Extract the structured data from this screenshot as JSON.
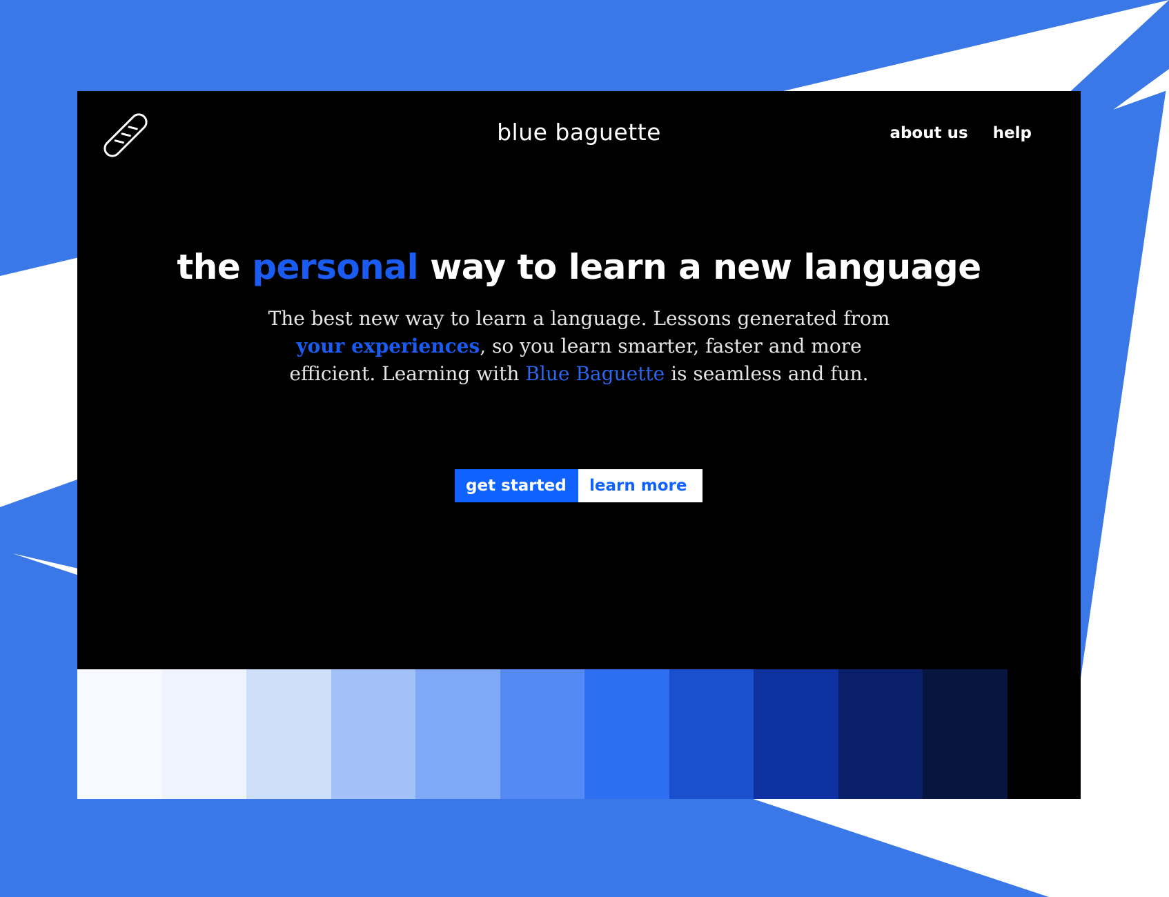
{
  "brand": {
    "title": "blue baguette",
    "logo_icon": "baguette-icon"
  },
  "nav": {
    "items": [
      {
        "label": "about us"
      },
      {
        "label": "help"
      }
    ]
  },
  "hero": {
    "headline_before": "the ",
    "headline_accent": "personal",
    "headline_after": " way to learn a new language",
    "sub_line1": "The best new way to learn a language. Lessons generated from",
    "sub_accent_bold": "your experiences",
    "sub_line2_rest": ", so you learn smarter, faster and more",
    "sub_line3_before": "efficient. Learning with ",
    "sub_accent": "Blue Baguette",
    "sub_line3_after": " is seamless and fun."
  },
  "cta": {
    "primary_label": "get started",
    "secondary_label": "learn more"
  },
  "colors": {
    "accent": "#0f62fe",
    "background": "#3b78e7",
    "window": "#000000"
  },
  "palette": [
    "#f7f9ff",
    "#eef3fd",
    "#cfdffa",
    "#a1c1f7",
    "#7fa8f7",
    "#5589f4",
    "#2d6ff1",
    "#1a4fce",
    "#0d32a0",
    "#0a1f6a",
    "#07153f"
  ]
}
